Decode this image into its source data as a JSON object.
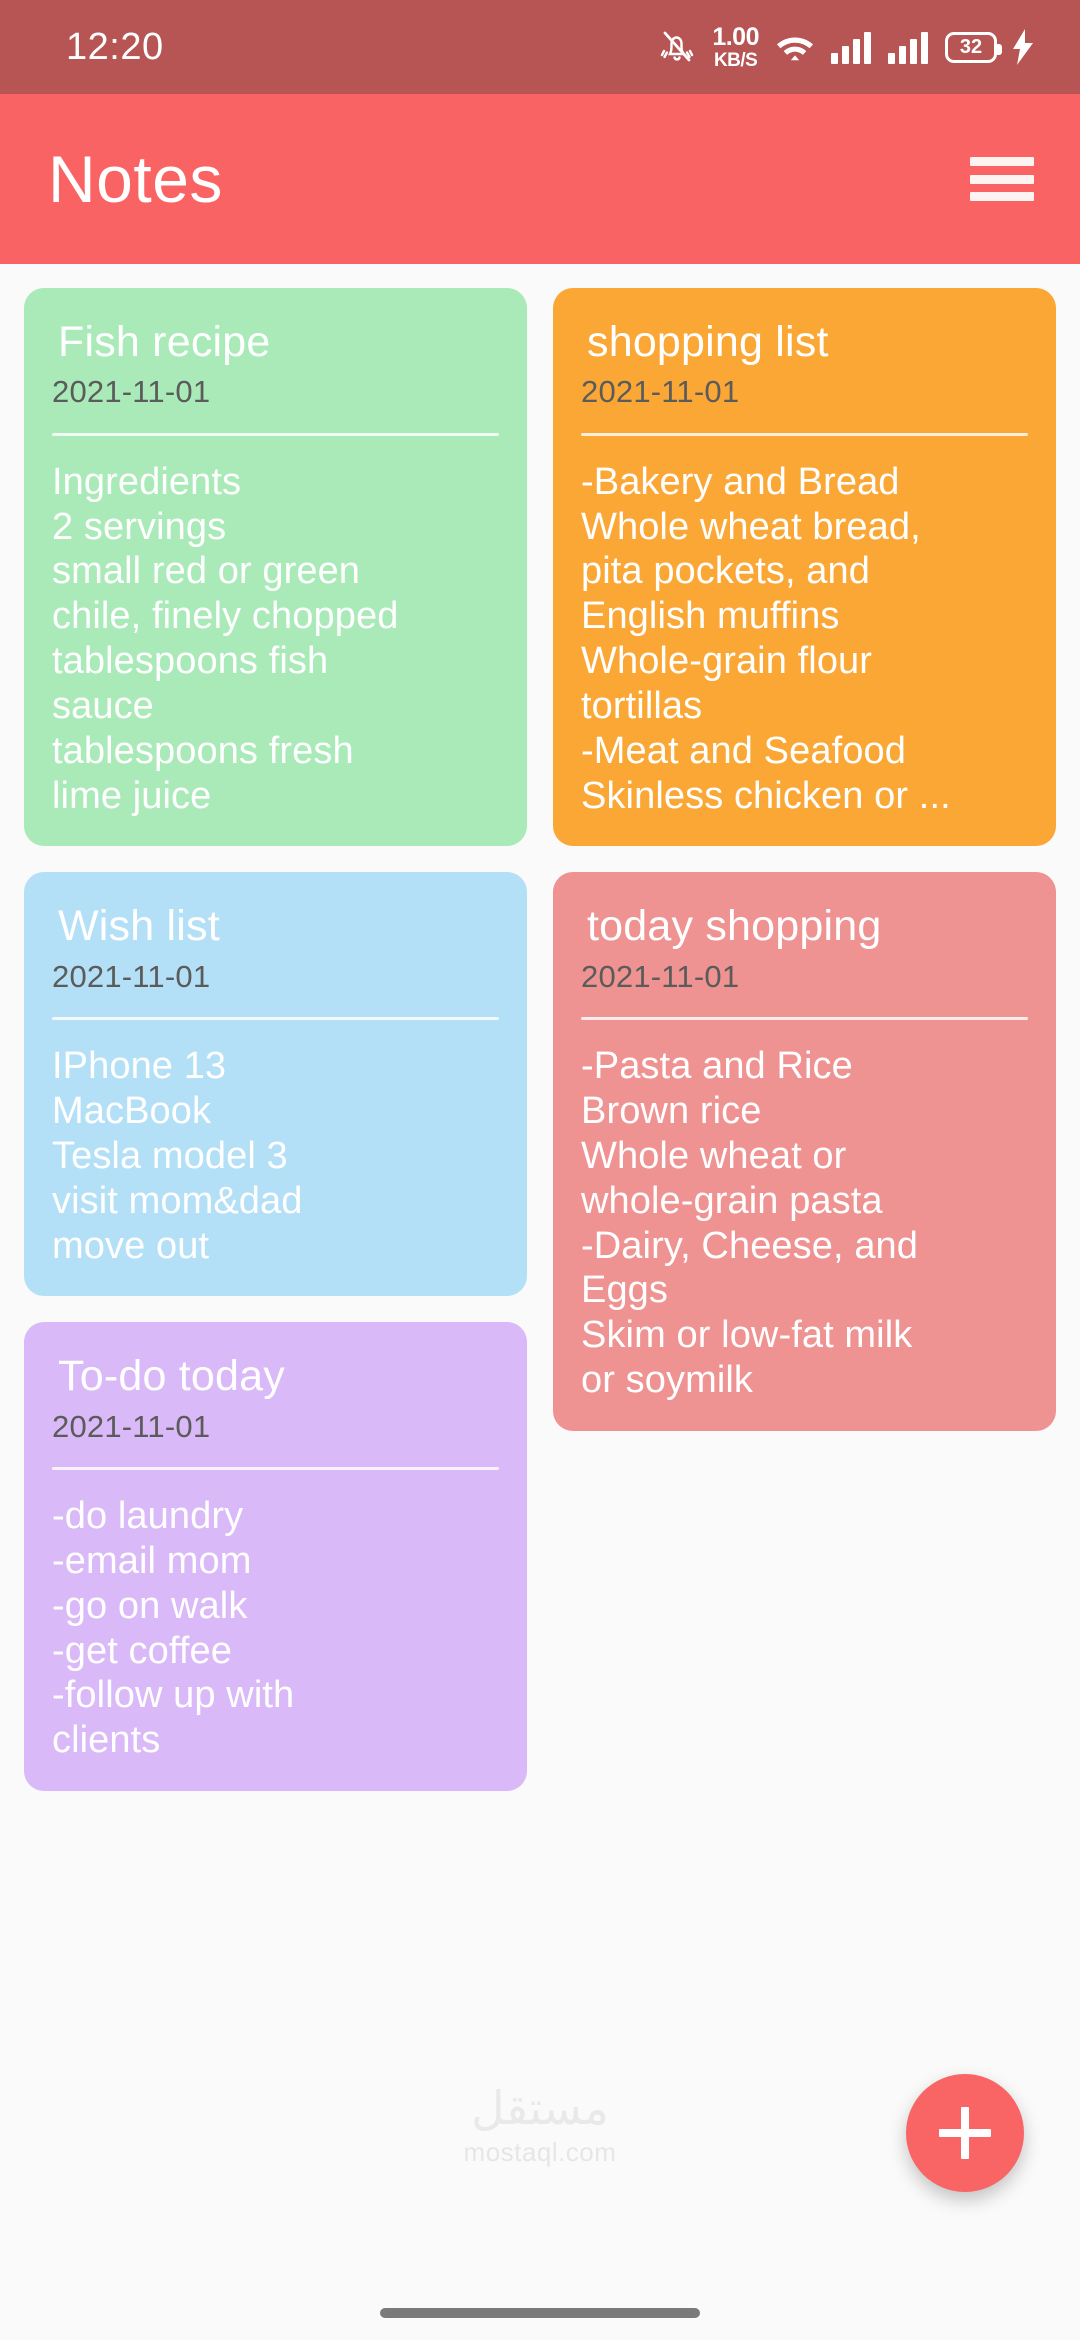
{
  "status_bar": {
    "time": "12:20",
    "net_speed_value": "1.00",
    "net_speed_unit": "KB/S",
    "battery_level": "32",
    "icons": [
      "mute-icon",
      "wifi-icon",
      "signal-icon",
      "signal-icon",
      "battery-icon",
      "charging-bolt-icon"
    ],
    "background_color": "#b75454"
  },
  "app_bar": {
    "title": "Notes",
    "menu_label": "menu",
    "background_color": "#fa6363"
  },
  "colors": {
    "accent": "#fa6363",
    "page_background": "#fafafa",
    "note_green": "#a9eab8",
    "note_orange": "#fba735",
    "note_blue": "#b3e0f7",
    "note_pink": "#ef9292",
    "note_purple": "#d9b9f7"
  },
  "notes": [
    {
      "title": "Fish recipe",
      "date": "2021-11-01",
      "body": "Ingredients\n2 servings\nsmall red or green\nchile, finely chopped\ntablespoons fish\nsauce\ntablespoons fresh\nlime juice",
      "color": "#a9eab8",
      "column": "left"
    },
    {
      "title": "shopping list",
      "date": "2021-11-01",
      "body": "-Bakery and Bread\nWhole wheat bread,\npita pockets, and\nEnglish muffins\nWhole-grain flour\ntortillas\n-Meat and Seafood\nSkinless chicken or ...",
      "color": "#fba735",
      "column": "right"
    },
    {
      "title": "Wish list",
      "date": "2021-11-01",
      "body": "IPhone 13\nMacBook\nTesla model 3\nvisit mom&dad\nmove out",
      "color": "#b3e0f7",
      "column": "left"
    },
    {
      "title": "today shopping",
      "date": "2021-11-01",
      "body": "-Pasta and Rice\nBrown rice\nWhole wheat or\nwhole-grain pasta\n-Dairy, Cheese, and\nEggs\nSkim or low-fat milk\nor soymilk",
      "color": "#ef9292",
      "column": "right"
    },
    {
      "title": "To-do today",
      "date": "2021-11-01",
      "body": "-do laundry\n-email mom\n-go on walk\n-get coffee\n-follow up with\nclients",
      "color": "#d9b9f7",
      "column": "left"
    }
  ],
  "fab": {
    "label": "+",
    "name": "add-note-button",
    "color": "#f96565"
  },
  "watermark": {
    "arabic": "مستقل",
    "domain": "mostaql.com"
  }
}
